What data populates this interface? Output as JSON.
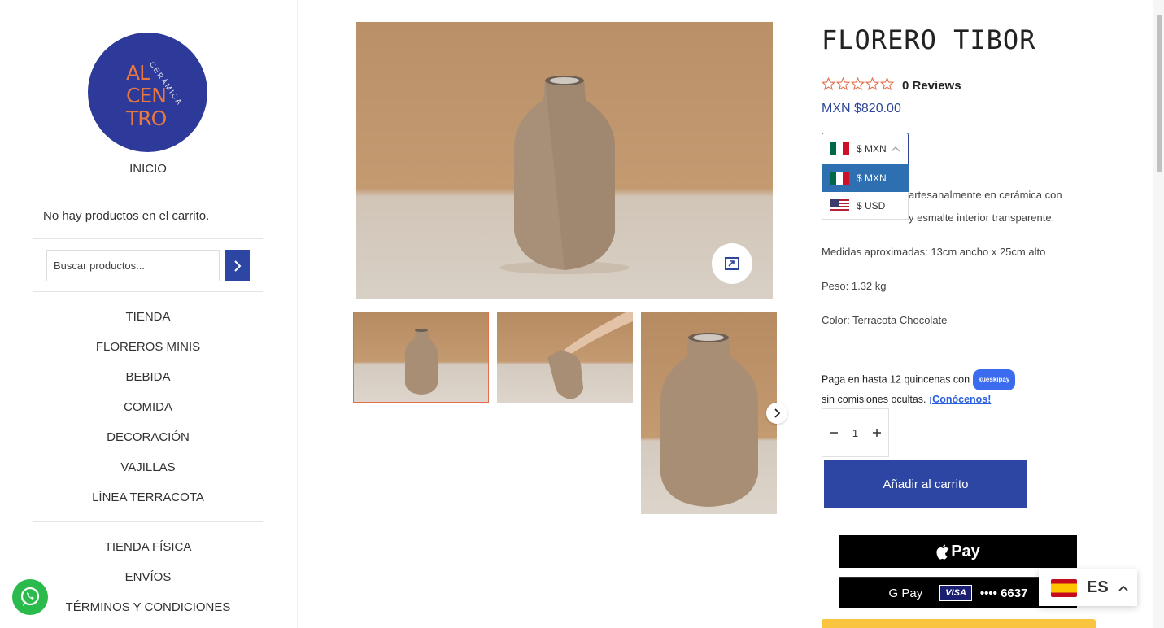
{
  "sidebar": {
    "logo": {
      "line1": "AL",
      "line2": "CEN",
      "line3": "TRO",
      "arc_text": "CERÁMICA"
    },
    "inicio": "INICIO",
    "cart_empty": "No hay productos en el carrito.",
    "search_placeholder": "Buscar productos...",
    "menu": [
      "TIENDA",
      "FLOREROS MINIS",
      "BEBIDA",
      "COMIDA",
      "DECORACIÓN",
      "VAJILLAS",
      "LÍNEA TERRACOTA"
    ],
    "menu2": [
      "TIENDA FÍSICA",
      "ENVÍOS",
      "TÉRMINOS Y CONDICIONES"
    ]
  },
  "product": {
    "title": "FLORERO TIBOR",
    "rating": 0,
    "reviews": "0 Reviews",
    "price": "MXN $820.00",
    "currency": {
      "selected": "$ MXN",
      "options": [
        "$ MXN",
        "$ USD"
      ]
    },
    "desc1": "artesanalmente en cerámica con",
    "desc1b": "y esmalte interior transparente.",
    "measures": "Medidas aproximadas: 13cm ancho x 25cm alto",
    "weight": "Peso: 1.32 kg",
    "color": "Color: Terracota Chocolate",
    "kueski_text": "Paga en hasta 12 quincenas con",
    "kueski_badge": "kueskipay",
    "kueski_text2": "sin comisiones ocultas.",
    "kueski_link": "¡Conócenos!",
    "quantity": "1",
    "add_to_cart": "Añadir al carrito",
    "apple_pay": "Pay",
    "gpay": "G Pay",
    "card_brand": "VISA",
    "card_last4": "•••• 6637"
  },
  "language": {
    "code": "ES"
  },
  "colors": {
    "brand_blue": "#2d45a3",
    "accent_orange": "#e36e4b",
    "whatsapp_green": "#2bbb4c"
  }
}
